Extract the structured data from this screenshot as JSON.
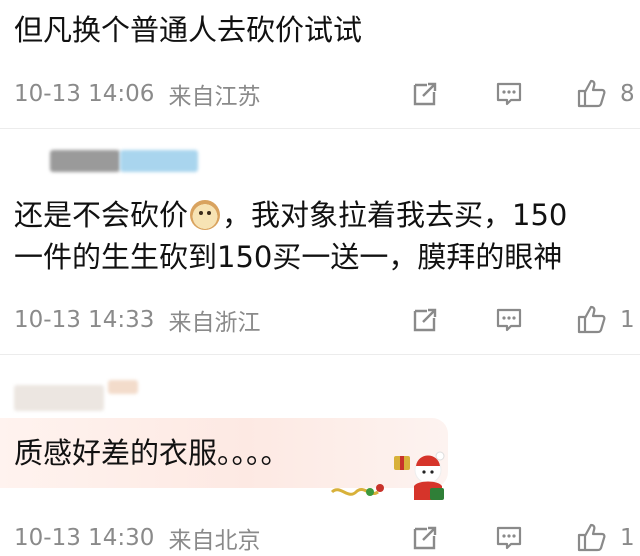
{
  "comments": [
    {
      "text": "但凡换个普通人去砍价试试",
      "time": "10-13 14:06",
      "location": "来自江苏",
      "likes": "8"
    },
    {
      "text_line1_a": "还是不会砍价",
      "text_line1_emoji": "doge-emoji",
      "text_line1_b": "，我对象拉着我去买，150",
      "text_line2": "一件的生生砍到150买一送一，膜拜的眼神",
      "time": "10-13 14:33",
      "location": "来自浙江",
      "likes": "1"
    },
    {
      "text": "质感好差的衣服。。。。",
      "time": "10-13 14:30",
      "location": "来自北京",
      "likes": "1"
    }
  ],
  "icons": {
    "share": "share-icon",
    "comment": "comment-icon",
    "like": "thumbs-up-icon"
  },
  "colors": {
    "meta_gray": "#8a8a8a",
    "text": "#111111",
    "bubble": "#fdebe5"
  }
}
